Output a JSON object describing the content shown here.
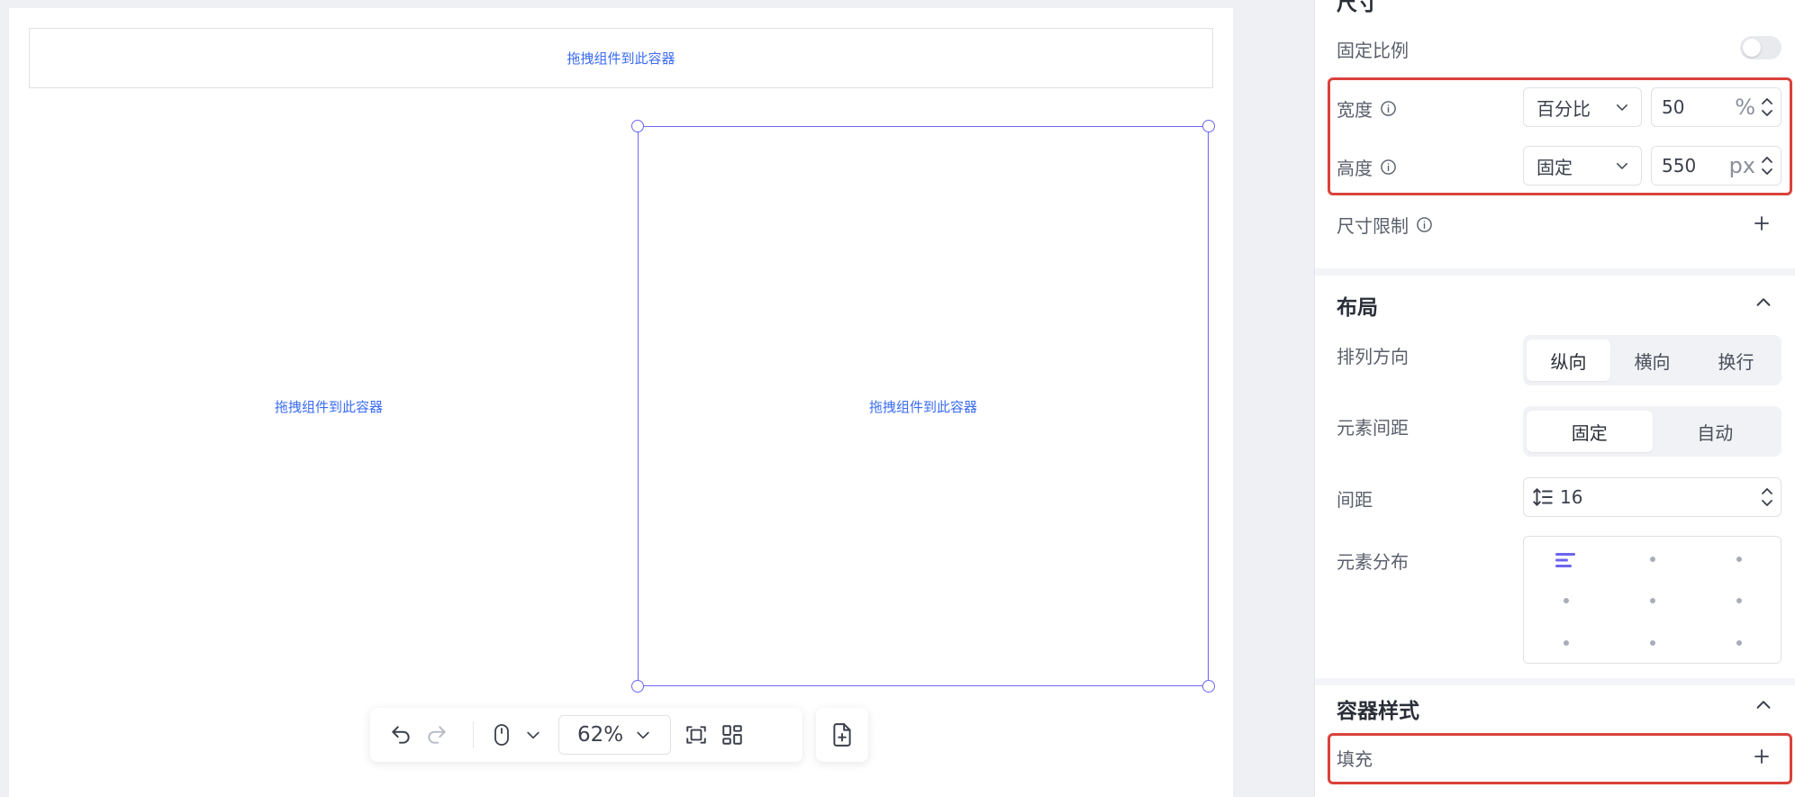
{
  "canvas": {
    "top_drop_text": "拖拽组件到此容器",
    "left_drop_text": "拖拽组件到此容器",
    "selected_drop_text": "拖拽组件到此容器"
  },
  "toolbar": {
    "zoom_value": "62%",
    "icons": [
      "undo-icon",
      "redo-icon",
      "mouse-icon",
      "chevron-down-icon",
      "fit-screen-icon",
      "layout-grid-icon",
      "add-page-icon"
    ]
  },
  "panel": {
    "size_section_title": "尺寸",
    "fixed_ratio_label": "固定比例",
    "fixed_ratio_on": false,
    "width": {
      "label": "宽度",
      "mode": "百分比",
      "value": "50",
      "unit": "%"
    },
    "height": {
      "label": "高度",
      "mode": "固定",
      "value": "550",
      "unit": "px"
    },
    "size_limit_label": "尺寸限制",
    "layout": {
      "title": "布局",
      "direction_label": "排列方向",
      "direction_options": [
        "纵向",
        "横向",
        "换行"
      ],
      "direction_selected": "纵向",
      "spacing_label": "元素间距",
      "spacing_options": [
        "固定",
        "自动"
      ],
      "spacing_selected": "固定",
      "gap_label": "间距",
      "gap_value": "16",
      "distribution_label": "元素分布"
    },
    "container_style": {
      "title": "容器样式",
      "fill_label": "填充"
    }
  },
  "colors": {
    "accent": "#6b66f0",
    "link_blue": "#3b6cf2",
    "highlight_red": "#d9423b"
  }
}
